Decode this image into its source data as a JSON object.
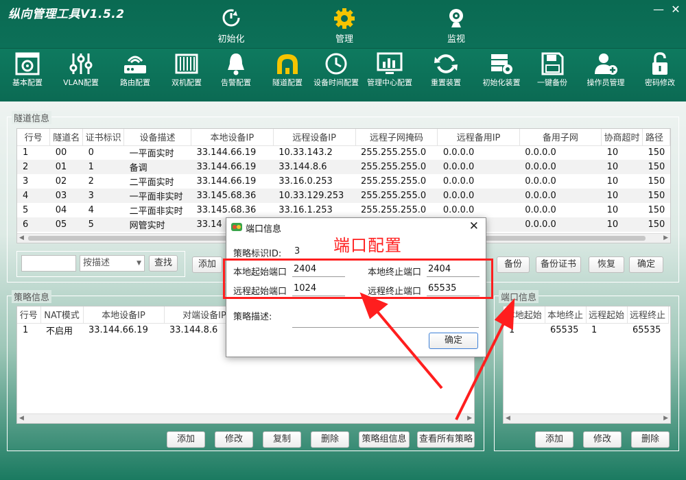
{
  "app": {
    "title": "纵向管理工具V1.5.2",
    "minimize": "—",
    "close": "✕"
  },
  "nav": [
    {
      "label": "初始化",
      "icon": "power-cycle-icon"
    },
    {
      "label": "管理",
      "icon": "gear-icon"
    },
    {
      "label": "监视",
      "icon": "webcam-icon"
    }
  ],
  "toolbar": [
    {
      "label": "基本配置",
      "icon": "settings-panel-icon"
    },
    {
      "label": "VLAN配置",
      "icon": "sliders-icon"
    },
    {
      "label": "路由配置",
      "icon": "router-icon"
    },
    {
      "label": "双机配置",
      "icon": "server-rack-icon"
    },
    {
      "label": "告警配置",
      "icon": "bell-icon"
    },
    {
      "label": "隧道配置",
      "icon": "tunnel-icon"
    },
    {
      "label": "设备时间配置",
      "icon": "clock-icon"
    },
    {
      "label": "管理中心配置",
      "icon": "monitor-chart-icon"
    },
    {
      "label": "重置装置",
      "icon": "refresh-icon"
    },
    {
      "label": "初始化装置",
      "icon": "server-gear-icon"
    },
    {
      "label": "一键备份",
      "icon": "floppy-icon"
    },
    {
      "label": "操作员管理",
      "icon": "add-user-icon"
    },
    {
      "label": "密码修改",
      "icon": "lock-icon"
    }
  ],
  "tunnel": {
    "legend": "隧道信息",
    "columns": [
      "行号",
      "隧道名",
      "证书标识",
      "设备描述",
      "本地设备IP",
      "远程设备IP",
      "远程子网掩码",
      "远程备用IP",
      "备用子网",
      "协商超时",
      "路径"
    ],
    "rows": [
      [
        "1",
        "00",
        "0",
        "一平面实时",
        "33.144.66.19",
        "10.33.143.2",
        "255.255.255.0",
        "0.0.0.0",
        "0.0.0.0",
        "10",
        "150"
      ],
      [
        "2",
        "01",
        "1",
        "备调",
        "33.144.66.19",
        "33.144.8.6",
        "255.255.255.0",
        "0.0.0.0",
        "0.0.0.0",
        "10",
        "150"
      ],
      [
        "3",
        "02",
        "2",
        "二平面实时",
        "33.144.66.19",
        "33.16.0.253",
        "255.255.255.0",
        "0.0.0.0",
        "0.0.0.0",
        "10",
        "150"
      ],
      [
        "4",
        "03",
        "3",
        "一平面非实时",
        "33.145.68.36",
        "10.33.129.253",
        "255.255.255.0",
        "0.0.0.0",
        "0.0.0.0",
        "10",
        "150"
      ],
      [
        "5",
        "04",
        "4",
        "二平面非实时",
        "33.145.68.36",
        "33.16.1.253",
        "255.255.255.0",
        "0.0.0.0",
        "0.0.0.0",
        "10",
        "150"
      ],
      [
        "6",
        "05",
        "5",
        "网管实时",
        "33.14",
        "",
        "",
        "",
        "0.0.0.0",
        "10",
        "150"
      ]
    ],
    "search_value": "",
    "filter_select": "按描述",
    "buttons": {
      "search": "查找",
      "add": "添加",
      "backup": "备份",
      "backup_cert": "备份证书",
      "restore": "恢复",
      "ok": "确定"
    }
  },
  "policy": {
    "legend": "策略信息",
    "columns": [
      "行号",
      "NAT模式",
      "本地设备IP",
      "对端设备IP"
    ],
    "rows": [
      [
        "1",
        "不启用",
        "33.144.66.19",
        "33.144.8.6"
      ]
    ],
    "buttons": {
      "add": "添加",
      "edit": "修改",
      "copy": "复制",
      "delete": "删除",
      "group_info": "策略组信息",
      "view_all": "查看所有策略"
    }
  },
  "port": {
    "legend": "端口信息",
    "columns": [
      "本地起始",
      "本地终止",
      "远程起始",
      "远程终止"
    ],
    "rows": [
      [
        "1",
        "65535",
        "1",
        "65535"
      ]
    ],
    "buttons": {
      "add": "添加",
      "edit": "修改",
      "delete": "删除"
    }
  },
  "dialog": {
    "title": "端口信息",
    "close": "✕",
    "policy_id_label": "策略标识ID:",
    "policy_id": "3",
    "local_start_label": "本地起始端口",
    "local_start": "2404",
    "local_end_label": "本地终止端口",
    "local_end": "2404",
    "remote_start_label": "远程起始端口",
    "remote_start": "1024",
    "remote_end_label": "远程终止端口",
    "remote_end": "65535",
    "desc_label": "策略描述:",
    "desc": "",
    "ok": "确定"
  },
  "annotation": {
    "text": "端口配置",
    "color": "#ff1e1e"
  }
}
